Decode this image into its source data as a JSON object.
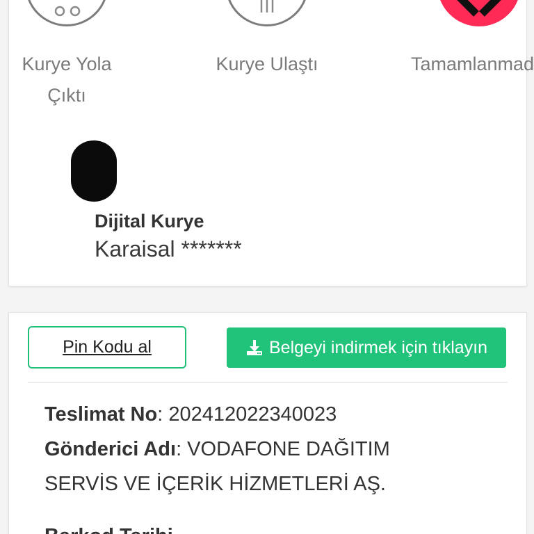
{
  "steps": [
    {
      "label_line1": "Kurye Yola",
      "label_line2": "Çıktı",
      "state": "done"
    },
    {
      "label_line1": "Kurye Ulaştı",
      "label_line2": "",
      "state": "done"
    },
    {
      "label_line1": "Tamamlanmad",
      "label_line2": "",
      "state": "failed"
    }
  ],
  "courier": {
    "title": "Dijital Kurye",
    "name": "Karaisal *******"
  },
  "actions": {
    "pin_label": "Pin Kodu al",
    "download_label": "Belgeyi indirmek için tıklayın"
  },
  "details": {
    "delivery_no_key": "Teslimat No",
    "delivery_no_value": ": 202412022340023",
    "sender_key": "Gönderici Adı",
    "sender_value": ": VODAFONE DAĞITIM SERVİS VE İÇERİK HİZMETLERİ AŞ.",
    "next_key": "Barkod Tarihi"
  },
  "colors": {
    "accent_green": "#21c27a",
    "fail_red": "#ff2a55",
    "step_gray": "#7d7d7d"
  },
  "icons": [
    "motorcycle-icon",
    "building-icon",
    "close-icon",
    "download-icon"
  ]
}
